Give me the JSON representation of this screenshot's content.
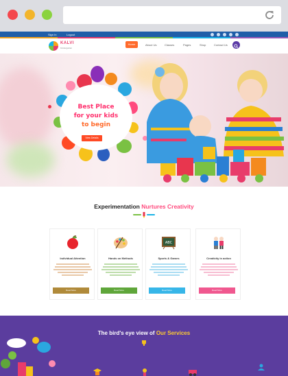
{
  "topbar": {
    "left_items": [
      "Sign In",
      "Logout"
    ],
    "social_icons": [
      "facebook-icon",
      "twitter-icon",
      "vimeo-icon",
      "google-plus-icon",
      "instagram-icon"
    ]
  },
  "brand": {
    "name": "KALVI",
    "tagline": "Kindergarten"
  },
  "nav": {
    "items": [
      "Home",
      "About Us",
      "Classes",
      "Pages",
      "Shop",
      "Contact Us"
    ],
    "active": "Home"
  },
  "hero": {
    "title_line1": "Best Place",
    "title_line2": "for your kids",
    "title_line3": "to begin",
    "button_label": "View Details"
  },
  "features": {
    "title_part1": "Experimentation ",
    "title_part2": "Nurtures Creativity",
    "cards": [
      {
        "icon": "apple-icon",
        "title": "Individual Attention",
        "button": "Read More",
        "color": "#b08a3a",
        "text_color": "#c27a2f"
      },
      {
        "icon": "paint-palette-icon",
        "title": "Hands on Methods",
        "button": "Read More",
        "color": "#5fa63a",
        "text_color": "#5fa63a"
      },
      {
        "icon": "chalkboard-icon",
        "title": "Sports & Games",
        "button": "Read More",
        "color": "#37b6e8",
        "text_color": "#37b6e8"
      },
      {
        "icon": "kids-icon",
        "title": "Creativity in action",
        "button": "Read More",
        "color": "#f0588f",
        "text_color": "#f0588f"
      }
    ]
  },
  "services": {
    "title_part1": "The bird's eye view of ",
    "title_part2": "Our Services"
  },
  "colors": {
    "accent_orange": "#ff6a2b",
    "accent_pink": "#ff4a7d",
    "brand_purple": "#5b3d9e",
    "topbar_blue": "#1f5ea8"
  }
}
